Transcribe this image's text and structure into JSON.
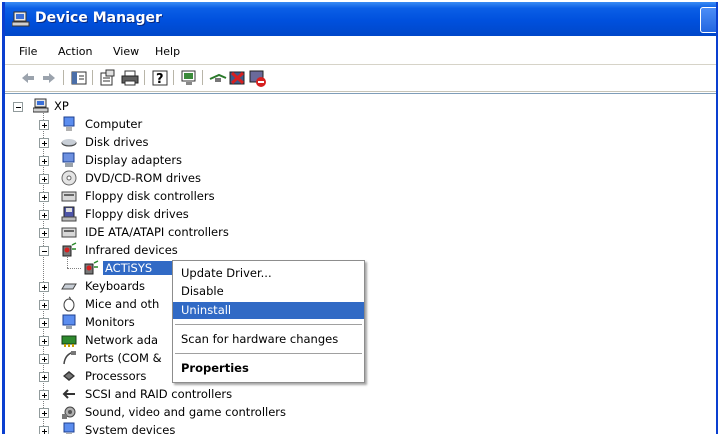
{
  "window": {
    "title": "Device Manager"
  },
  "menu": {
    "items": [
      "File",
      "Action",
      "View",
      "Help"
    ]
  },
  "toolbar": {
    "buttons": [
      "back-icon",
      "forward-icon",
      "show-hide-tree-icon",
      "properties-icon",
      "print-icon",
      "help-icon",
      "scan-hardware-icon",
      "update-driver-icon",
      "uninstall-icon",
      "disable-icon"
    ]
  },
  "tree": {
    "root": "XP",
    "items": [
      {
        "label": "Computer",
        "icon": "computer-icon"
      },
      {
        "label": "Disk drives",
        "icon": "disk-drive-icon"
      },
      {
        "label": "Display adapters",
        "icon": "display-adapter-icon"
      },
      {
        "label": "DVD/CD-ROM drives",
        "icon": "dvd-drive-icon"
      },
      {
        "label": "Floppy disk controllers",
        "icon": "floppy-controller-icon"
      },
      {
        "label": "Floppy disk drives",
        "icon": "floppy-drive-icon"
      },
      {
        "label": "IDE ATA/ATAPI controllers",
        "icon": "ide-controller-icon"
      },
      {
        "label": "Infrared devices",
        "icon": "infrared-icon",
        "expanded": true
      },
      {
        "label": "ACTiSYS",
        "icon": "infrared-device-icon",
        "child": true,
        "selected": true
      },
      {
        "label": "Keyboards",
        "icon": "keyboard-icon"
      },
      {
        "label": "Mice and oth",
        "icon": "mouse-icon"
      },
      {
        "label": "Monitors",
        "icon": "monitor-icon"
      },
      {
        "label": "Network ada",
        "icon": "network-adapter-icon"
      },
      {
        "label": "Ports (COM &",
        "icon": "port-icon"
      },
      {
        "label": "Processors",
        "icon": "processor-icon"
      },
      {
        "label": "SCSI and RAID controllers",
        "icon": "scsi-icon"
      },
      {
        "label": "Sound, video and game controllers",
        "icon": "sound-icon"
      },
      {
        "label": "System devices",
        "icon": "system-devices-icon"
      }
    ]
  },
  "context_menu": {
    "update_driver": "Update Driver...",
    "disable": "Disable",
    "uninstall": "Uninstall",
    "scan": "Scan for hardware changes",
    "properties": "Properties"
  }
}
